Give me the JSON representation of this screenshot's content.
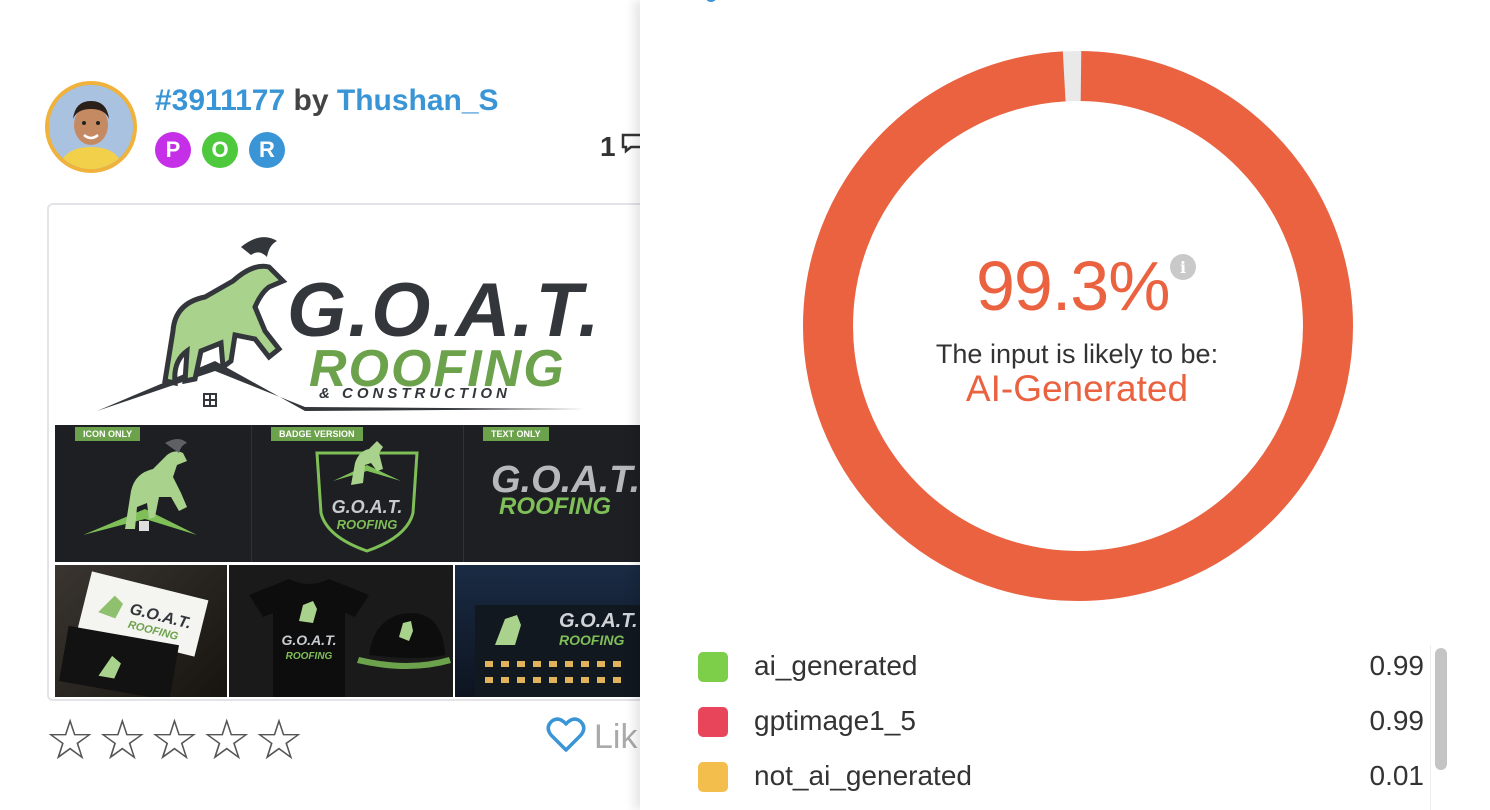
{
  "entry": {
    "id": "#3911177",
    "by": "by",
    "username": "Thushan_S",
    "badges": [
      {
        "letter": "P",
        "color": "#c52fe8"
      },
      {
        "letter": "O",
        "color": "#4ec83c"
      },
      {
        "letter": "R",
        "color": "#3a95d6"
      }
    ],
    "comment_count": "1",
    "like_label": "Lik",
    "rating_stars": 0
  },
  "logo": {
    "title": "G.O.A.T.",
    "line2": "ROOFING",
    "line3": "& CONSTRUCTION",
    "tags": [
      "ICON ONLY",
      "BADGE VERSION",
      "TEXT ONLY"
    ]
  },
  "detection": {
    "percent": "99.3%",
    "percent_value": 99.3,
    "subtitle": "The input is likely to be:",
    "verdict": "AI-Generated",
    "accent_color": "#ea6240",
    "legend": [
      {
        "label": "ai_generated",
        "value": "0.99",
        "color": "#7dce48"
      },
      {
        "label": "gptimage1_5",
        "value": "0.99",
        "color": "#e8455b"
      },
      {
        "label": "not_ai_generated",
        "value": "0.01",
        "color": "#f4be4c"
      }
    ]
  }
}
